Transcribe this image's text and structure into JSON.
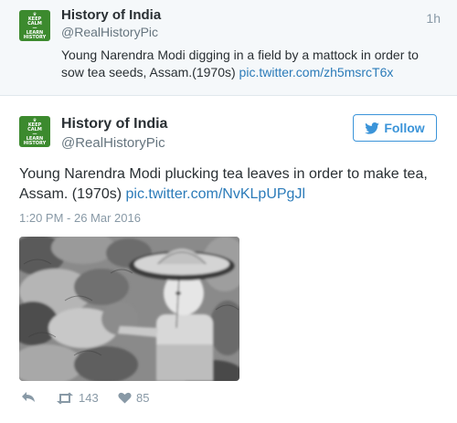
{
  "tweet1": {
    "avatar_lines": [
      "KEEP",
      "CALM",
      "—",
      "LEARN",
      "HISTORY"
    ],
    "name": "History of India",
    "handle": "@RealHistoryPic",
    "time": "1h",
    "text": "Young Narendra Modi digging in a field by a mattock in order to sow tea seeds, Assam.(1970s) ",
    "link": "pic.twitter.com/zh5msrcT6x"
  },
  "tweet2": {
    "avatar_lines": [
      "KEEP",
      "CALM",
      "—",
      "LEARN",
      "HISTORY"
    ],
    "name": "History of India",
    "handle": "@RealHistoryPic",
    "follow_label": "Follow",
    "text": "Young Narendra Modi plucking tea leaves in order to make tea, Assam. (1970s) ",
    "link": "pic.twitter.com/NvKLpUPgJl",
    "date": "1:20 PM - 26 Mar 2016",
    "retweets": "143",
    "likes": "85"
  },
  "colors": {
    "avatar_green": "#3c8a2e",
    "link_blue": "#2b7bb9",
    "follow_blue": "#3b94d9",
    "meta_gray": "#8899a6"
  },
  "icons": [
    "twitter-bird-icon",
    "reply-icon",
    "retweet-icon",
    "heart-icon"
  ]
}
